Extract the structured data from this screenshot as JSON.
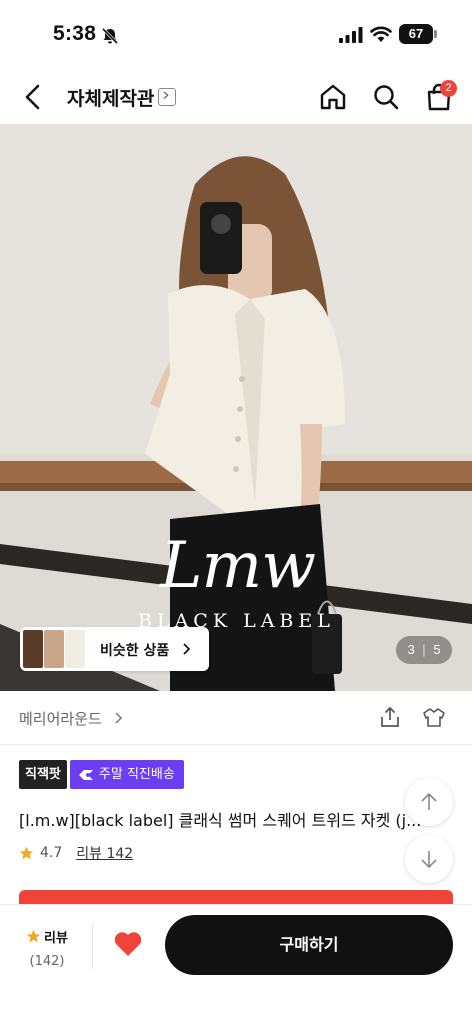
{
  "status_bar": {
    "time": "5:38",
    "battery": "67"
  },
  "header": {
    "title": "자체제작관",
    "cart_count": "2"
  },
  "gallery": {
    "brand_logo": "Lmw",
    "brand_sub": "BLACK LABEL",
    "similar_label": "비슷한 상품",
    "counter_current": "3",
    "counter_total": "5"
  },
  "store": {
    "name": "메리어라운드"
  },
  "badges": {
    "badge1": "직잭팟",
    "badge2": "주말 직진배송"
  },
  "product": {
    "title": "[l.m.w][black label] 클래식 썸머 스퀘어 트위드 자켓 (j...",
    "rating": "4.7",
    "review_link": "리뷰 142"
  },
  "bottom_bar": {
    "review_label": "리뷰",
    "review_count": "(142)",
    "buy_label": "구매하기"
  },
  "colors": {
    "accent_red": "#f0433a",
    "purple": "#6b3ef2",
    "star": "#f5a623"
  }
}
